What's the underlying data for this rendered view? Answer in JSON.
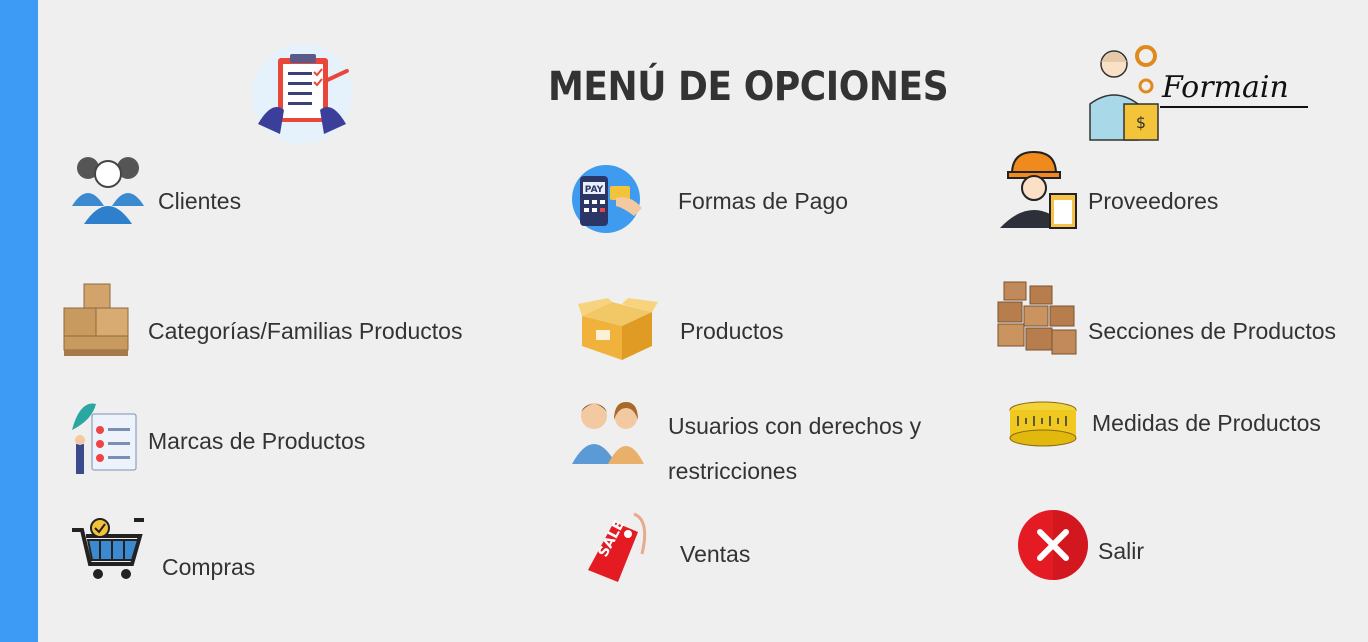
{
  "header": {
    "title": "MENÚ DE OPCIONES",
    "brand": "Formain"
  },
  "menu": {
    "clientes": "Clientes",
    "formas_pago": "Formas de Pago",
    "proveedores": "Proveedores",
    "categorias": "Categorías/Familias Productos",
    "productos": "Productos",
    "secciones": "Secciones de Productos",
    "marcas": "Marcas de Productos",
    "usuarios": "Usuarios con derechos y restricciones",
    "medidas": "Medidas de Productos",
    "compras": "Compras",
    "ventas": "Ventas",
    "salir": "Salir"
  },
  "icons": {
    "header": "clipboard-checklist-icon",
    "brand": "worker-gears-icon",
    "clientes": "users-group-icon",
    "formas_pago": "payment-terminal-icon",
    "proveedores": "engineer-icon",
    "categorias": "stacked-boxes-icon",
    "productos": "open-box-icon",
    "secciones": "boxes-pile-icon",
    "marcas": "checklist-board-icon",
    "usuarios": "people-icon",
    "medidas": "measuring-tape-icon",
    "compras": "shopping-cart-icon",
    "ventas": "sale-tag-icon",
    "salir": "close-icon"
  },
  "colors": {
    "sidebar": "#3d9bf5",
    "background": "#efefef",
    "exit": "#e41b23"
  }
}
